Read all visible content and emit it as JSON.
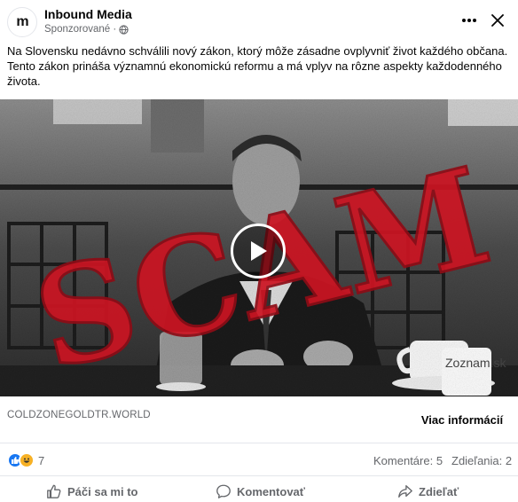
{
  "post": {
    "page_name": "Inbound Media",
    "avatar_text": "m",
    "sponsored_label": "Sponzorované ·",
    "text": "Na Slovensku nedávno schválili nový zákon, ktorý môže zásadne ovplyvniť život každého občana. Tento zákon prináša významnú ekonomickú reformu a má vplyv na rôzne aspekty každodenného života."
  },
  "media": {
    "overlay_stamp": "SCAM",
    "mug_brand": "Zoznam.sk"
  },
  "link": {
    "domain": "COLDZONEGOLDTR.WORLD",
    "cta_label": "Viac informácií"
  },
  "stats": {
    "reaction_count": "7",
    "comments": "Komentáre: 5",
    "shares": "Zdieľania: 2"
  },
  "actions": {
    "like": "Páči sa mi to",
    "comment": "Komentovať",
    "share": "Zdieľať"
  },
  "colors": {
    "stamp_red": "#cc1422",
    "accent_blue": "#1877f2"
  },
  "icons": [
    "globe-icon",
    "more-icon",
    "close-icon",
    "play-icon",
    "like-icon",
    "comment-icon",
    "share-icon"
  ]
}
